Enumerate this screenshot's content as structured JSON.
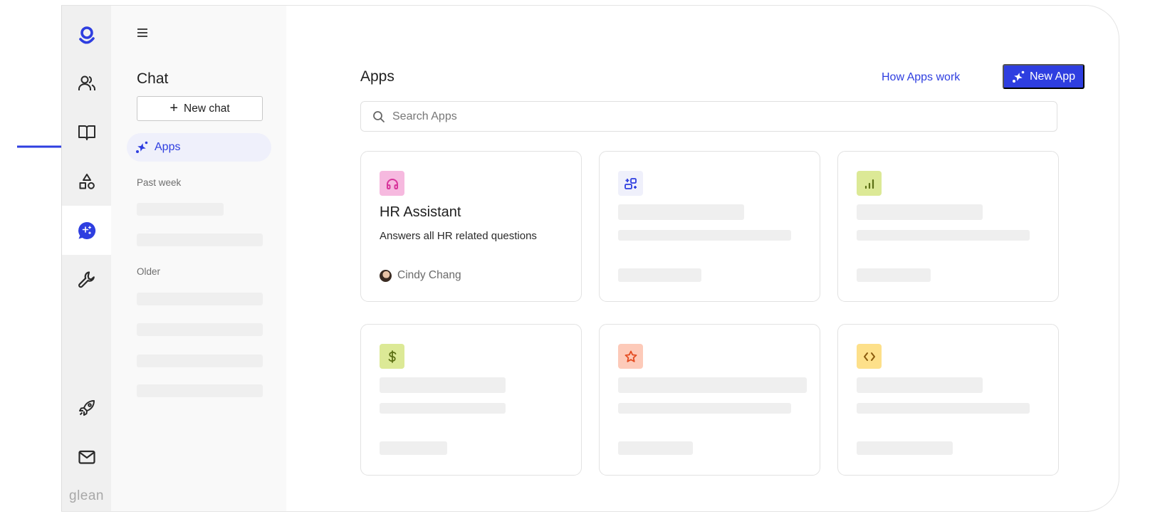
{
  "rail": {
    "items": [
      {
        "name": "glean-home",
        "icon": "glean-g-icon"
      },
      {
        "name": "people",
        "icon": "people-icon"
      },
      {
        "name": "knowledge",
        "icon": "book-icon"
      },
      {
        "name": "shapes",
        "icon": "shapes-icon"
      },
      {
        "name": "chat",
        "icon": "chat-sparkle-icon",
        "active": true
      },
      {
        "name": "tools",
        "icon": "wrench-icon"
      },
      {
        "name": "launch",
        "icon": "rocket-icon"
      },
      {
        "name": "mail",
        "icon": "mail-icon"
      }
    ],
    "logo_text": "glean"
  },
  "sidebar": {
    "title": "Chat",
    "new_chat_label": "New chat",
    "apps_label": "Apps",
    "past_week_label": "Past week",
    "older_label": "Older"
  },
  "main": {
    "title": "Apps",
    "how_link": "How Apps work",
    "new_app_label": "New App",
    "search_placeholder": "Search Apps",
    "search_value": "",
    "cards": [
      {
        "title": "HR Assistant",
        "description": "Answers all HR related questions",
        "author": "Cindy Chang",
        "icon": "headphones-icon",
        "icon_bg": "#f6b9df",
        "icon_color": "#d8359b"
      },
      {
        "title": "",
        "description": "",
        "author": "",
        "icon": "shapes-plus-icon",
        "icon_bg": "#eff0fb",
        "icon_color": "#2e3ee0",
        "loading": true
      },
      {
        "title": "",
        "description": "",
        "author": "",
        "icon": "bar-chart-icon",
        "icon_bg": "#dce996",
        "icon_color": "#5c7014",
        "loading": true
      },
      {
        "title": "",
        "description": "",
        "author": "",
        "icon": "dollar-icon",
        "icon_bg": "#dce996",
        "icon_color": "#5c7014",
        "loading": true
      },
      {
        "title": "",
        "description": "",
        "author": "",
        "icon": "star-icon",
        "icon_bg": "#fdcab9",
        "icon_color": "#e44a1f",
        "loading": true
      },
      {
        "title": "",
        "description": "",
        "author": "",
        "icon": "code-icon",
        "icon_bg": "#fde08a",
        "icon_color": "#8a5a0d",
        "loading": true
      }
    ]
  },
  "colors": {
    "accent": "#2e3ee0",
    "skeleton": "#efefef"
  }
}
